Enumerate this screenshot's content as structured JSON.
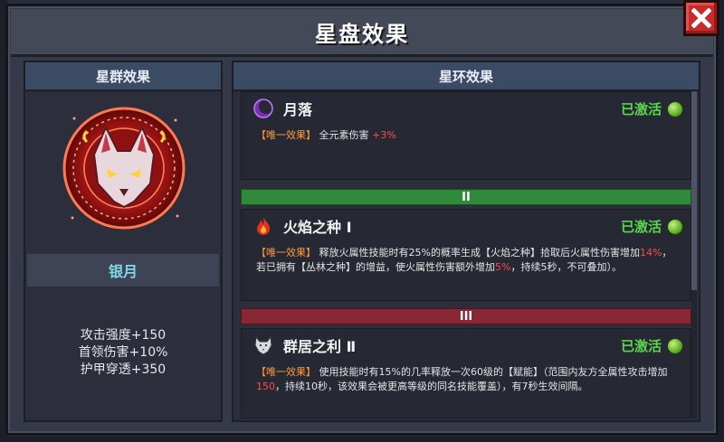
{
  "window": {
    "title": "星盘效果"
  },
  "left": {
    "header": "星群效果",
    "star_name": "银月",
    "stats": [
      "攻击强度+150",
      "首领伤害+10%",
      "护甲穿透+350"
    ]
  },
  "right": {
    "header": "星环效果",
    "rings": [
      {
        "name": "月落",
        "status": "已激活",
        "icon": "crescent-moon-icon",
        "desc": [
          {
            "t": "【唯一效果】",
            "c": "tag"
          },
          {
            "t": " 全元素伤害 ",
            "c": ""
          },
          {
            "t": "+3%",
            "c": "hl"
          }
        ]
      },
      {
        "tier": "II",
        "name": "火焰之种 Ⅰ",
        "status": "已激活",
        "icon": "flame-icon",
        "desc": [
          {
            "t": "【唯一效果】",
            "c": "tag"
          },
          {
            "t": " 释放火属性技能时有25%的概率生成【火焰之种】拾取后火属性伤害增加",
            "c": ""
          },
          {
            "t": "14%",
            "c": "hl"
          },
          {
            "t": "，若已拥有【丛林之种】的增益，使火属性伤害额外增加",
            "c": ""
          },
          {
            "t": "5%",
            "c": "hl"
          },
          {
            "t": "，持续5秒，不可叠加）。",
            "c": ""
          }
        ]
      },
      {
        "tier": "III",
        "name": "群居之利 Ⅱ",
        "status": "已激活",
        "icon": "wolf-head-icon",
        "desc": [
          {
            "t": "【唯一效果】",
            "c": "tag"
          },
          {
            "t": " 使用技能时有15%的几率释放一次60级的【赋能】（范围内友方全属性攻击增加 ",
            "c": ""
          },
          {
            "t": "150",
            "c": "hl"
          },
          {
            "t": "，持续10秒，该效果会被更高等级的同名技能覆盖），有7秒生效间隔。",
            "c": ""
          }
        ]
      }
    ]
  },
  "colors": {
    "accent_green": "#59d64a",
    "tag_orange": "#ff9a3c",
    "highlight_red": "#ff4a4a",
    "star_name_cyan": "#7fd8e6",
    "close_red": "#c92b2b"
  }
}
